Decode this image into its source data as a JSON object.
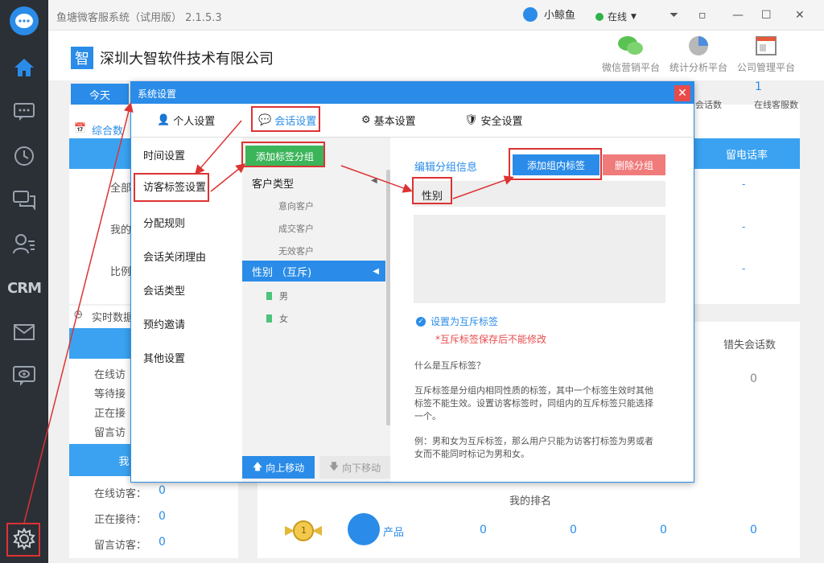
{
  "app": {
    "title": "鱼塘微客服系统（试用版） 2.1.5.3",
    "user": "小鲸鱼",
    "status": "在线"
  },
  "sidebar": {
    "items": [
      "home-icon",
      "chat-icon",
      "history-icon",
      "messages-icon",
      "contacts-icon",
      "CRM",
      "mail-icon",
      "monitor-icon",
      "settings-icon"
    ],
    "crm_label": "CRM"
  },
  "company": {
    "badge": "智",
    "name": "深圳大智软件技术有限公司"
  },
  "platforms": [
    {
      "label": "微信营销平台",
      "icon": "wechat-icon"
    },
    {
      "label": "统计分析平台",
      "icon": "pie-chart-icon"
    },
    {
      "label": "公司管理平台",
      "icon": "window-icon"
    }
  ],
  "bg": {
    "today": "今天",
    "summary_label": "综合数",
    "stat_labels": [
      "全部",
      "我的",
      "比例"
    ],
    "stat_col_label": "留电话率",
    "stat_small": [
      "会话数",
      "在线客服数"
    ],
    "stat_small_value": "1",
    "dashes": [
      "-",
      "-",
      "-"
    ],
    "realtime": "实时数据",
    "realtime_items": [
      "在线访",
      "等待接",
      "正在接",
      "留言访"
    ],
    "strip_label": "我",
    "bottom_items": [
      {
        "label": "在线访客：",
        "value": "0"
      },
      {
        "label": "正在接待：",
        "value": "0"
      },
      {
        "label": "留言访客：",
        "value": "0"
      }
    ],
    "missed_label": "错失会话数",
    "missed_value": "0",
    "rank_title": "我的排名",
    "rank_product": "产品",
    "rank_badge": "1",
    "rank_values": [
      "0",
      "0",
      "0",
      "0"
    ]
  },
  "dialog": {
    "title": "系统设置",
    "tabs": [
      "个人设置",
      "会话设置",
      "基本设置",
      "安全设置"
    ],
    "menu": [
      "时间设置",
      "访客标签设置",
      "分配规则",
      "会话关闭理由",
      "会话类型",
      "预约邀请",
      "其他设置"
    ],
    "add_group": "添加标签分组",
    "groups": [
      {
        "title": "客户类型",
        "items": [
          "意向客户",
          "成交客户",
          "无效客户"
        ]
      },
      {
        "title": "性别 （互斥)",
        "items": [
          "男",
          "女"
        ]
      }
    ],
    "move_up": "向上移动",
    "move_down": "向下移动",
    "edit_title": "编辑分组信息",
    "add_tag": "添加组内标签",
    "del_group": "删除分组",
    "group_name": "性别",
    "mutex_label": "设置为互斥标签",
    "mutex_warn": "*互斥标签保存后不能修改",
    "help_q": "什么是互斥标签？",
    "help_p1": "互斥标签是分组内相同性质的标签，其中一个标签生效时其他标签不能生效。设置访客标签时，同组内的互斥标签只能选择一个。",
    "help_p2": "例：男和女为互斥标签，那么用户只能为访客打标签为男或者女而不能同时标记为男和女。"
  },
  "colors": {
    "primary": "#2a8ce8",
    "green": "#3cb55a",
    "red": "#f07b7b",
    "annotation": "#dd3333"
  }
}
